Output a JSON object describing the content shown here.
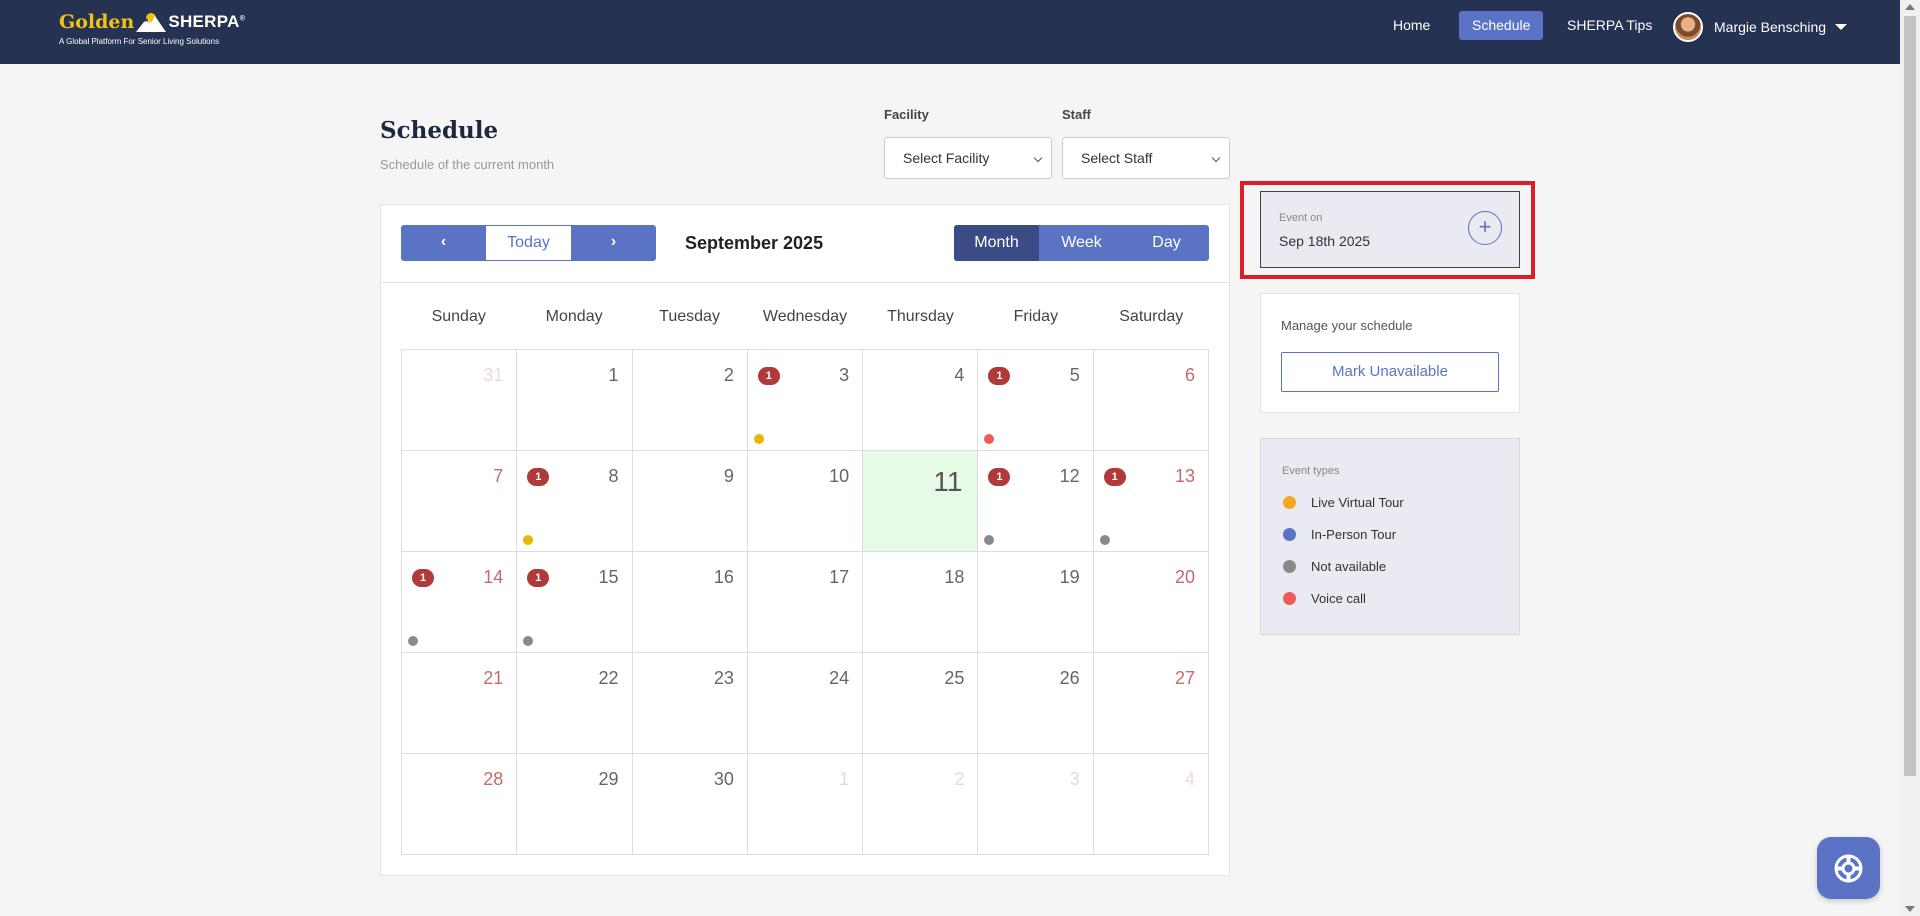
{
  "navbar": {
    "logo_golden": "Golden",
    "logo_sherpa": "SHERPA",
    "logo_tagline": "A Global Platform For Senior Living Solutions",
    "links": [
      "Home",
      "Schedule",
      "SHERPA Tips"
    ],
    "active_link": "Schedule",
    "user_name": "Margie Bensching"
  },
  "header": {
    "title": "Schedule",
    "subtitle": "Schedule of the current month",
    "facility_label": "Facility",
    "facility_value": "Select Facility",
    "staff_label": "Staff",
    "staff_value": "Select Staff"
  },
  "calendar": {
    "prev_label": "‹",
    "today_label": "Today",
    "next_label": "›",
    "month_title": "September 2025",
    "views": [
      "Month",
      "Week",
      "Day"
    ],
    "active_view": "Month",
    "weekdays": [
      "Sunday",
      "Monday",
      "Tuesday",
      "Wednesday",
      "Thursday",
      "Friday",
      "Saturday"
    ],
    "weeks": [
      [
        {
          "day": "31",
          "other": true
        },
        {
          "day": "1"
        },
        {
          "day": "2"
        },
        {
          "day": "3",
          "badge": "1",
          "dot": "live_virtual"
        },
        {
          "day": "4"
        },
        {
          "day": "5",
          "badge": "1",
          "dot": "voice_call"
        },
        {
          "day": "6"
        }
      ],
      [
        {
          "day": "7"
        },
        {
          "day": "8",
          "badge": "1",
          "dot": "live_virtual"
        },
        {
          "day": "9"
        },
        {
          "day": "10"
        },
        {
          "day": "11",
          "today": true
        },
        {
          "day": "12",
          "badge": "1",
          "dot": "not_available"
        },
        {
          "day": "13",
          "badge": "1",
          "dot": "not_available"
        }
      ],
      [
        {
          "day": "14",
          "badge": "1",
          "dot": "not_available"
        },
        {
          "day": "15",
          "badge": "1",
          "dot": "not_available"
        },
        {
          "day": "16"
        },
        {
          "day": "17"
        },
        {
          "day": "18"
        },
        {
          "day": "19"
        },
        {
          "day": "20"
        }
      ],
      [
        {
          "day": "21"
        },
        {
          "day": "22"
        },
        {
          "day": "23"
        },
        {
          "day": "24"
        },
        {
          "day": "25"
        },
        {
          "day": "26"
        },
        {
          "day": "27"
        }
      ],
      [
        {
          "day": "28"
        },
        {
          "day": "29"
        },
        {
          "day": "30"
        },
        {
          "day": "1",
          "other": true
        },
        {
          "day": "2",
          "other": true
        },
        {
          "day": "3",
          "other": true
        },
        {
          "day": "4",
          "other": true
        }
      ]
    ]
  },
  "event_panel": {
    "label": "Event on",
    "date": "Sep 18th 2025",
    "add_label": "+"
  },
  "manage_panel": {
    "label": "Manage your schedule",
    "button_label": "Mark Unavailable"
  },
  "event_types": {
    "label": "Event types",
    "items": [
      {
        "key": "live_virtual",
        "label": "Live Virtual Tour",
        "color": "#f5a623"
      },
      {
        "key": "in_person",
        "label": "In-Person Tour",
        "color": "#5a73c4"
      },
      {
        "key": "not_available",
        "label": "Not available",
        "color": "#8a8a8a"
      },
      {
        "key": "voice_call",
        "label": "Voice call",
        "color": "#f05a5a"
      }
    ],
    "dot_colors": {
      "live_virtual": "#e6b800",
      "in_person": "#5a73c4",
      "not_available": "#8a8a8a",
      "voice_call": "#f05a5a"
    }
  }
}
